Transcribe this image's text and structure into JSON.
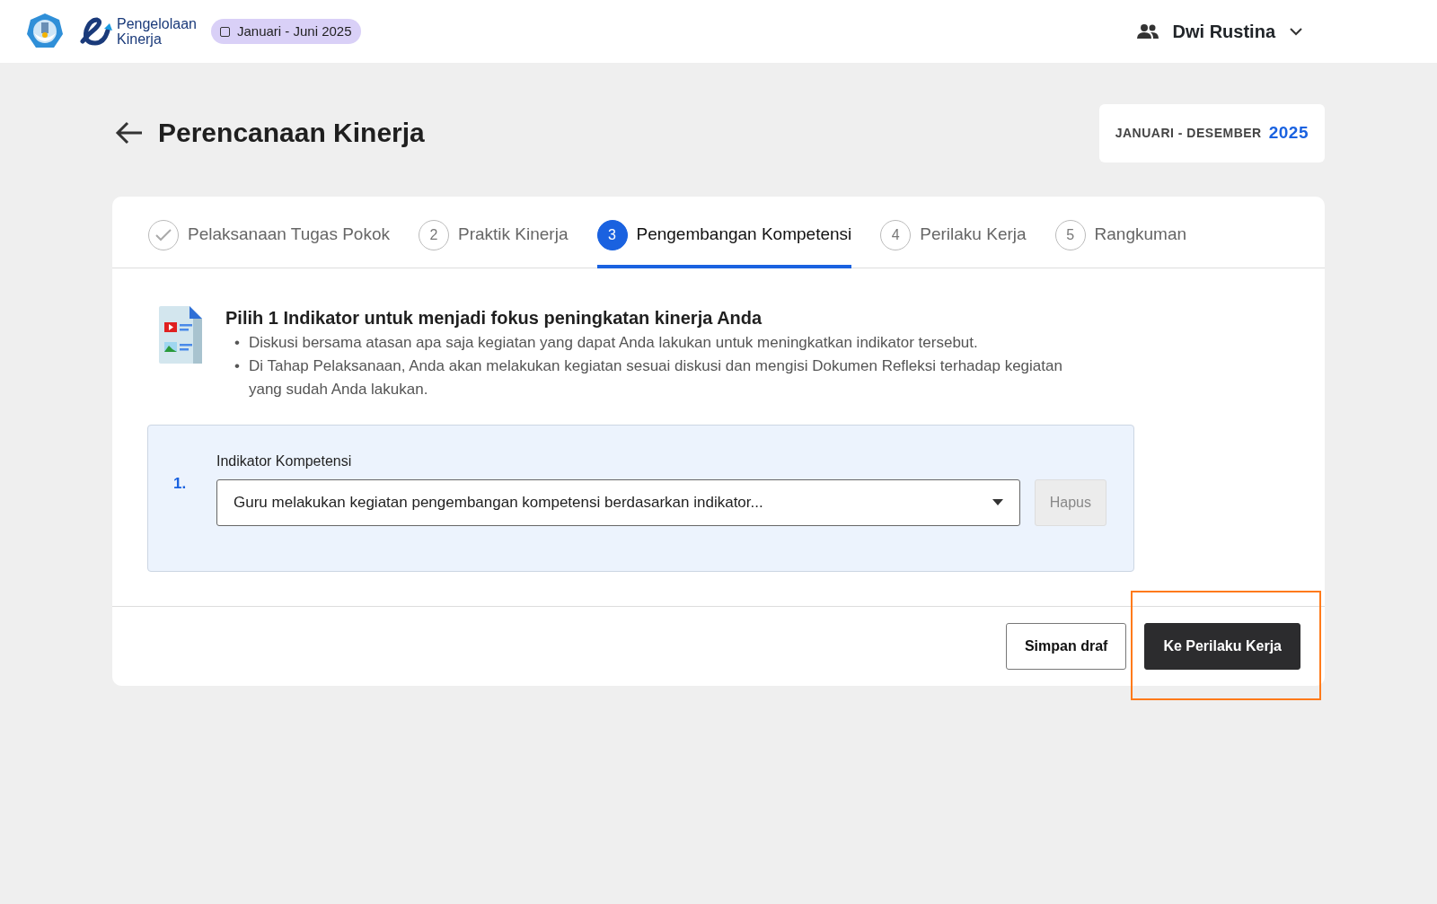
{
  "header": {
    "brand_line1": "Pengelolaan",
    "brand_line2": "Kinerja",
    "period_badge": "Januari - Juni 2025",
    "user": "Dwi Rustina"
  },
  "page": {
    "title": "Perencanaan Kinerja",
    "period_label": "JANUARI - DESEMBER",
    "period_year": "2025"
  },
  "steps": [
    {
      "label": "Pelaksanaan Tugas Pokok",
      "completed": true,
      "selected": false
    },
    {
      "number": "2",
      "label": "Praktik Kinerja",
      "completed": false,
      "selected": false
    },
    {
      "number": "3",
      "label": "Pengembangan Kompetensi",
      "completed": false,
      "selected": true
    },
    {
      "number": "4",
      "label": "Perilaku Kerja",
      "completed": false,
      "selected": false
    },
    {
      "number": "5",
      "label": "Rangkuman",
      "completed": false,
      "selected": false
    }
  ],
  "intro": {
    "heading": "Pilih 1 Indikator untuk menjadi fokus peningkatan kinerja Anda",
    "bullets": [
      {
        "marker": "•",
        "text": "Diskusi bersama atasan apa saja kegiatan yang dapat Anda lakukan untuk meningkatkan indikator tersebut."
      },
      {
        "marker": "•",
        "text": "Di Tahap Pelaksanaan, Anda akan melakukan kegiatan sesuai diskusi dan mengisi Dokumen Refleksi terhadap kegiatan yang sudah Anda lakukan."
      }
    ]
  },
  "indicators": [
    {
      "number": "1.",
      "label": "Indikator Kompetensi",
      "value": "Guru melakukan kegiatan pengembangan kompetensi berdasarkan indikator...",
      "delete_button": "Hapus",
      "delete_disabled": true
    }
  ],
  "footer": {
    "buttons": [
      {
        "label": "Simpan draf",
        "kind": "secondary",
        "highlighted": false
      },
      {
        "label": "Ke Perilaku Kerja",
        "kind": "primary",
        "highlighted": true
      }
    ]
  }
}
